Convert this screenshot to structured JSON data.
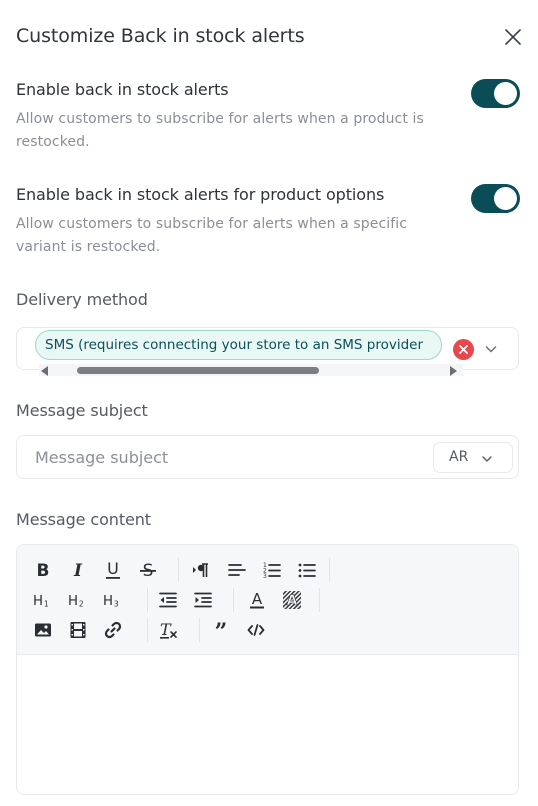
{
  "modal": {
    "title": "Customize Back in stock alerts",
    "close_icon": "close-icon"
  },
  "options": [
    {
      "title": "Enable back in stock alerts",
      "description": "Allow customers to subscribe for alerts when a product is restocked.",
      "enabled": true
    },
    {
      "title": "Enable back in stock alerts for product options",
      "description": "Allow customers to subscribe for alerts when a specific variant is restocked.",
      "enabled": true
    }
  ],
  "delivery": {
    "label": "Delivery method",
    "selected": [
      "SMS (requires connecting your store to an SMS provider"
    ]
  },
  "subject": {
    "label": "Message subject",
    "placeholder": "Message subject",
    "value": "",
    "language": "AR"
  },
  "content": {
    "label": "Message content",
    "toolbar": [
      "bold-icon",
      "italic-icon",
      "underline-icon",
      "strikethrough-icon",
      "paragraph-direction-icon",
      "align-left-icon",
      "ordered-list-icon",
      "bullet-list-icon",
      "heading-1-icon",
      "heading-2-icon",
      "heading-3-icon",
      "outdent-icon",
      "indent-icon",
      "text-color-icon",
      "background-color-icon",
      "image-icon",
      "video-icon",
      "link-icon",
      "clear-formatting-icon",
      "blockquote-icon",
      "code-icon"
    ]
  },
  "colors": {
    "toggle_on": "#0a4d57",
    "chip_bg": "#e9f7f5",
    "chip_border": "#9ad9d1",
    "clear_red": "#e5484d"
  }
}
